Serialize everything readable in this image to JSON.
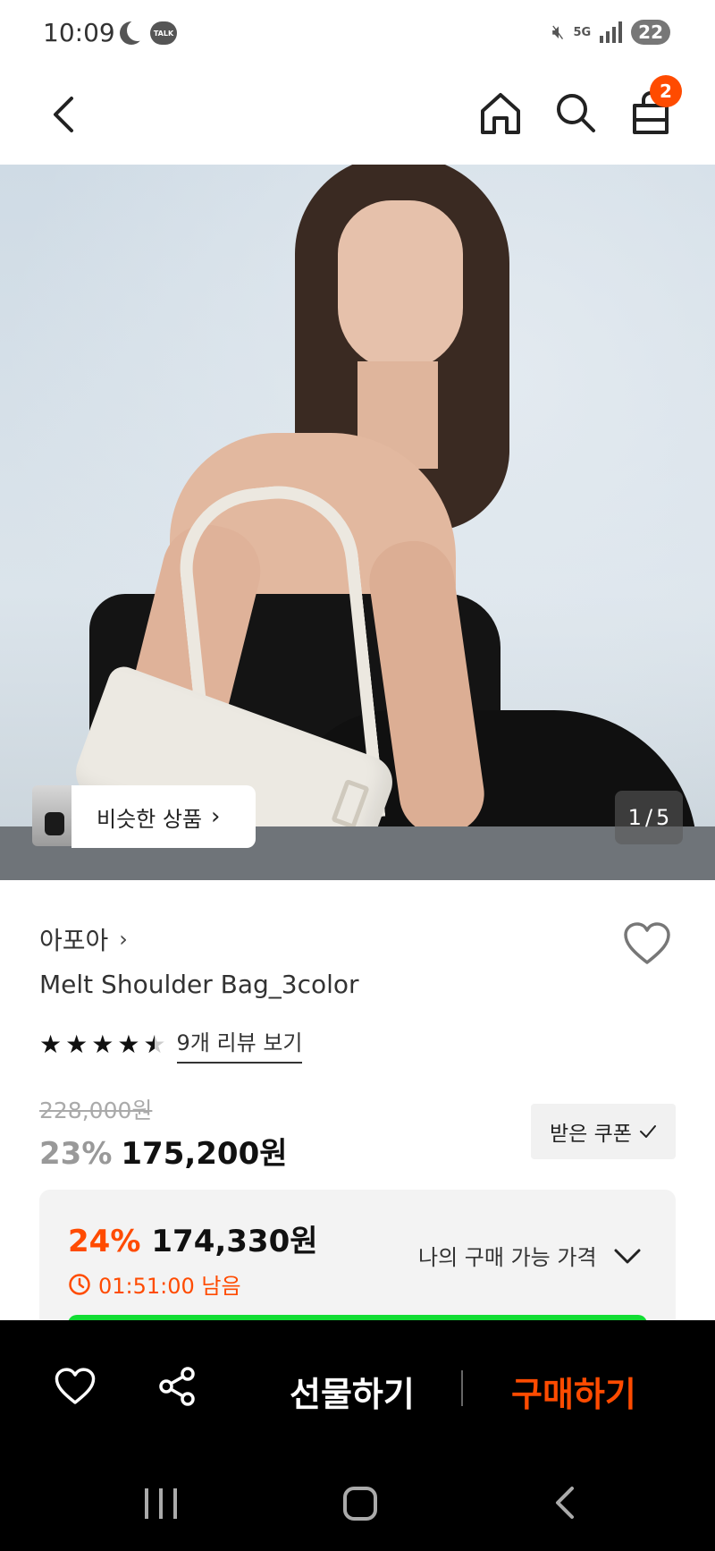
{
  "status_bar": {
    "time": "10:09",
    "network": "5G",
    "battery": "22",
    "icons": [
      "moon-icon",
      "kakaotalk-icon",
      "mute-icon",
      "5g-icon",
      "signal-icon",
      "battery-icon"
    ]
  },
  "top_nav": {
    "icons": [
      "back-icon",
      "home-icon",
      "search-icon",
      "cart-icon"
    ],
    "cart_badge": "2",
    "badge_color": "#ff4b00"
  },
  "gallery": {
    "similar_label": "비슷한 상품",
    "similar_chevron": "›",
    "pager_current": "1",
    "pager_sep": "/",
    "pager_total": "5"
  },
  "product": {
    "brand": "아포아",
    "brand_chevron": "›",
    "name": "Melt Shoulder Bag_3color",
    "rating": 4.5,
    "stars_max": 5,
    "review_link": "9개 리뷰 보기",
    "original_price": "228,000원",
    "discount": "23%",
    "sale_price": "175,200원",
    "coupon_label": "받은 쿠폰"
  },
  "my_price": {
    "discount": "24%",
    "price": "174,330원",
    "timer": "01:51:00 남음",
    "label": "나의 구매 가능 가격",
    "accent_color": "#ff4b00"
  },
  "action_bar": {
    "gift_label": "선물하기",
    "buy_label": "구매하기",
    "buy_color": "#ff4b00"
  },
  "system_nav": {
    "icons": [
      "recent-apps-icon",
      "home-circle-icon",
      "back-icon"
    ]
  }
}
